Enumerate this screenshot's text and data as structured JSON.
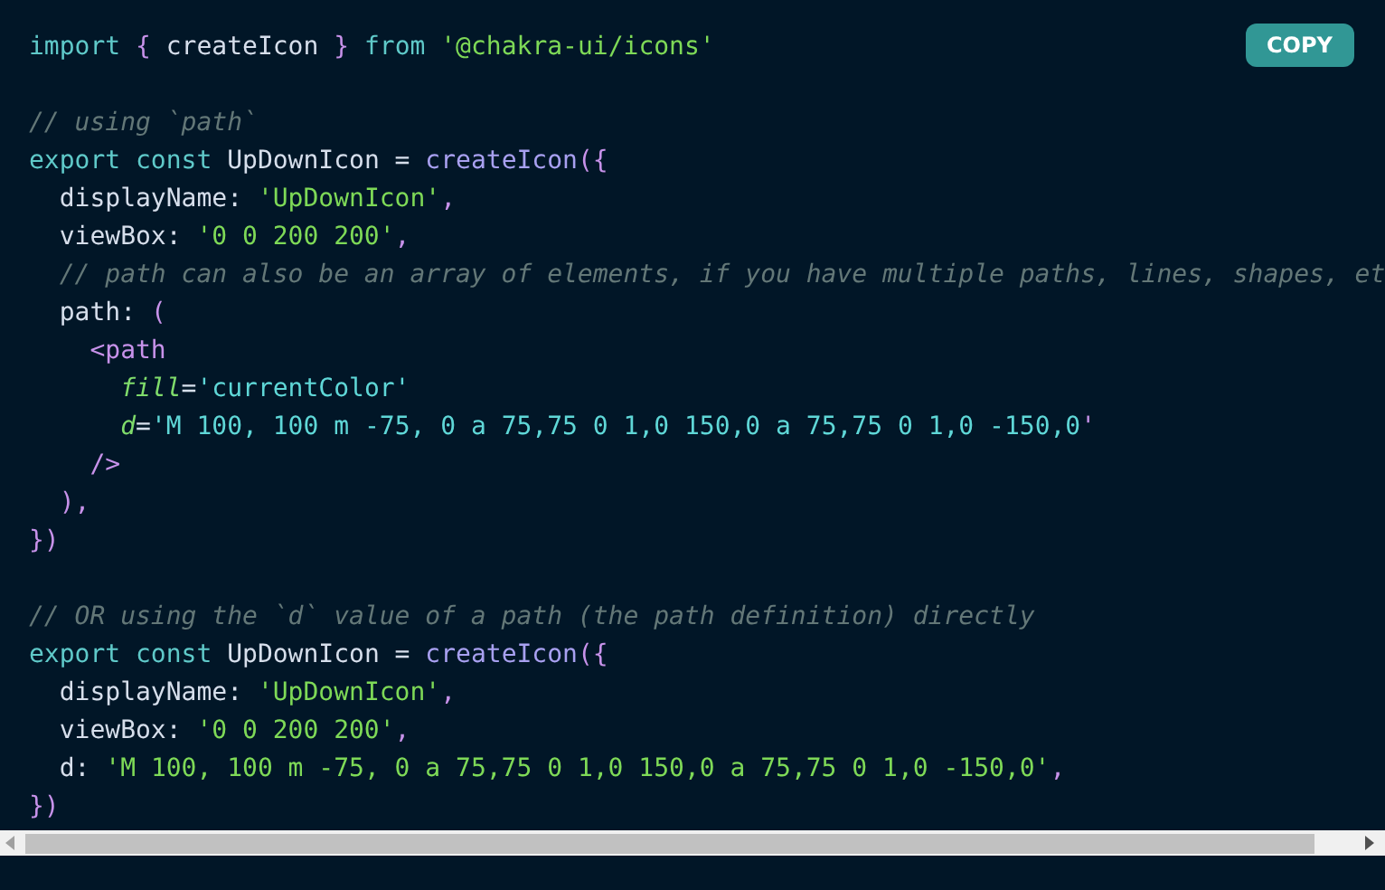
{
  "copy_button": {
    "label": "COPY"
  },
  "code_lines": [
    {
      "kind": "code",
      "tokens": [
        {
          "kind": "keyword",
          "text": "import "
        },
        {
          "kind": "punct",
          "text": "{"
        },
        {
          "kind": "plain",
          "text": " createIcon "
        },
        {
          "kind": "punct",
          "text": "} "
        },
        {
          "kind": "keyword",
          "text": "from "
        },
        {
          "kind": "string",
          "text": "'@chakra-ui/icons'"
        }
      ]
    },
    {
      "kind": "blank"
    },
    {
      "kind": "code",
      "tokens": [
        {
          "kind": "comment",
          "text": "// using `path`"
        }
      ]
    },
    {
      "kind": "code",
      "tokens": [
        {
          "kind": "keyword",
          "text": "export const"
        },
        {
          "kind": "plain",
          "text": " UpDownIcon = "
        },
        {
          "kind": "function",
          "text": "createIcon"
        },
        {
          "kind": "punct",
          "text": "({"
        }
      ]
    },
    {
      "kind": "code",
      "tokens": [
        {
          "kind": "plain",
          "text": "  displayName: "
        },
        {
          "kind": "string",
          "text": "'UpDownIcon'"
        },
        {
          "kind": "punct",
          "text": ","
        }
      ]
    },
    {
      "kind": "code",
      "tokens": [
        {
          "kind": "plain",
          "text": "  viewBox: "
        },
        {
          "kind": "string",
          "text": "'0 0 200 200'"
        },
        {
          "kind": "punct",
          "text": ","
        }
      ]
    },
    {
      "kind": "code",
      "tokens": [
        {
          "kind": "comment",
          "text": "  // path can also be an array of elements, if you have multiple paths, lines, shapes, et"
        }
      ]
    },
    {
      "kind": "code",
      "tokens": [
        {
          "kind": "plain",
          "text": "  path: "
        },
        {
          "kind": "punct",
          "text": "("
        }
      ]
    },
    {
      "kind": "code",
      "tokens": [
        {
          "kind": "tag",
          "text": "    <path"
        }
      ]
    },
    {
      "kind": "code",
      "tokens": [
        {
          "kind": "attr",
          "text": "      fill"
        },
        {
          "kind": "plain",
          "text": "="
        },
        {
          "kind": "attrval",
          "text": "'currentColor'"
        }
      ]
    },
    {
      "kind": "code",
      "tokens": [
        {
          "kind": "attr",
          "text": "      d"
        },
        {
          "kind": "plain",
          "text": "="
        },
        {
          "kind": "attrval",
          "text": "'M 100, 100 m -75, 0 a 75,75 0 1,0 150,0 a 75,75 0 1,0 -150,0"
        },
        {
          "kind": "punct",
          "text": "'"
        }
      ]
    },
    {
      "kind": "code",
      "tokens": [
        {
          "kind": "tag",
          "text": "    />"
        }
      ]
    },
    {
      "kind": "code",
      "tokens": [
        {
          "kind": "punct",
          "text": "  ),"
        }
      ]
    },
    {
      "kind": "code",
      "tokens": [
        {
          "kind": "punct",
          "text": "})"
        }
      ]
    },
    {
      "kind": "blank"
    },
    {
      "kind": "code",
      "tokens": [
        {
          "kind": "comment",
          "text": "// OR using the `d` value of a path (the path definition) directly"
        }
      ]
    },
    {
      "kind": "code",
      "tokens": [
        {
          "kind": "keyword",
          "text": "export const"
        },
        {
          "kind": "plain",
          "text": " UpDownIcon = "
        },
        {
          "kind": "function",
          "text": "createIcon"
        },
        {
          "kind": "punct",
          "text": "({"
        }
      ]
    },
    {
      "kind": "code",
      "tokens": [
        {
          "kind": "plain",
          "text": "  displayName: "
        },
        {
          "kind": "string",
          "text": "'UpDownIcon'"
        },
        {
          "kind": "punct",
          "text": ","
        }
      ]
    },
    {
      "kind": "code",
      "tokens": [
        {
          "kind": "plain",
          "text": "  viewBox: "
        },
        {
          "kind": "string",
          "text": "'0 0 200 200'"
        },
        {
          "kind": "punct",
          "text": ","
        }
      ]
    },
    {
      "kind": "code",
      "tokens": [
        {
          "kind": "plain",
          "text": "  d: "
        },
        {
          "kind": "string",
          "text": "'M 100, 100 m -75, 0 a 75,75 0 1,0 150,0 a 75,75 0 1,0 -150,0'"
        },
        {
          "kind": "punct",
          "text": ","
        }
      ]
    },
    {
      "kind": "code",
      "tokens": [
        {
          "kind": "punct",
          "text": "})"
        }
      ]
    }
  ]
}
